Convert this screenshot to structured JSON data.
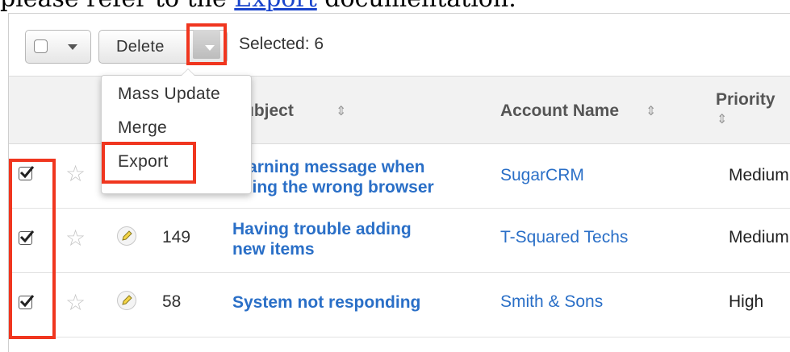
{
  "doc": {
    "prefix": "please refer to the ",
    "link": "Export",
    "suffix": " documentation."
  },
  "toolbar": {
    "delete_label": "Delete",
    "selected_text": "Selected: 6"
  },
  "menu": {
    "items": [
      "Mass Update",
      "Merge",
      "Export"
    ]
  },
  "columns": {
    "subject": "Subject",
    "account": "Account Name",
    "priority": "Priority"
  },
  "rows": [
    {
      "checked": true,
      "number": "",
      "subject_line1": "Warning message when",
      "subject_line2": "using the wrong browser",
      "account": "SugarCRM",
      "priority": "Medium"
    },
    {
      "checked": true,
      "number": "149",
      "subject_line1": "Having trouble adding",
      "subject_line2": "new items",
      "account": "T-Squared Techs",
      "priority": "Medium"
    },
    {
      "checked": true,
      "number": "58",
      "subject_line1": "System not responding",
      "subject_line2": "",
      "account": "Smith & Sons",
      "priority": "High"
    }
  ],
  "colors": {
    "highlight": "#f0361f",
    "link": "#2a6fc7"
  },
  "icons": [
    "checkbox-icon",
    "chevron-down-icon",
    "star-icon",
    "pencil-icon",
    "sort-icon"
  ]
}
